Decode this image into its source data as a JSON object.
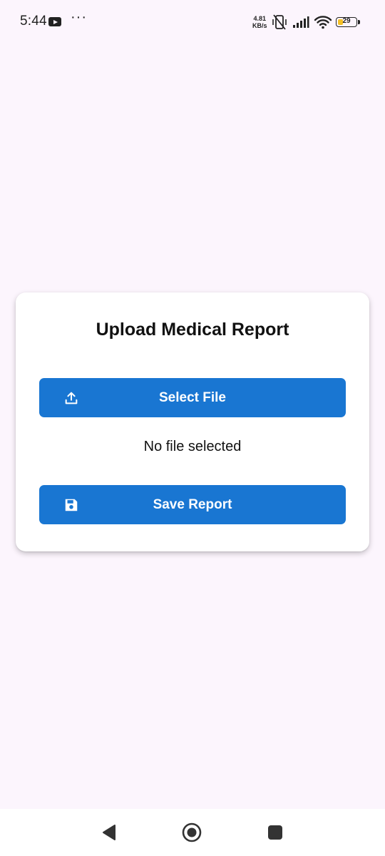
{
  "status_bar": {
    "time": "5:44",
    "net_speed_value": "4.81",
    "net_speed_unit": "KB/s",
    "battery_level": "29",
    "battery_fraction": 0.29,
    "icons": [
      "youtube-icon",
      "more-dots-icon",
      "vibrate-off-icon",
      "signal-icon",
      "wifi-icon",
      "battery-icon"
    ]
  },
  "card": {
    "title": "Upload Medical Report",
    "select_button": {
      "label": "Select File",
      "icon": "upload-icon"
    },
    "file_status": "No file selected",
    "save_button": {
      "label": "Save Report",
      "icon": "save-icon"
    }
  },
  "nav_bar": {
    "icons": [
      "back-icon",
      "home-icon",
      "recents-icon"
    ]
  },
  "colors": {
    "background": "#fcf5fd",
    "button": "#1976d2",
    "card": "#ffffff",
    "battery": "#f4c025"
  }
}
